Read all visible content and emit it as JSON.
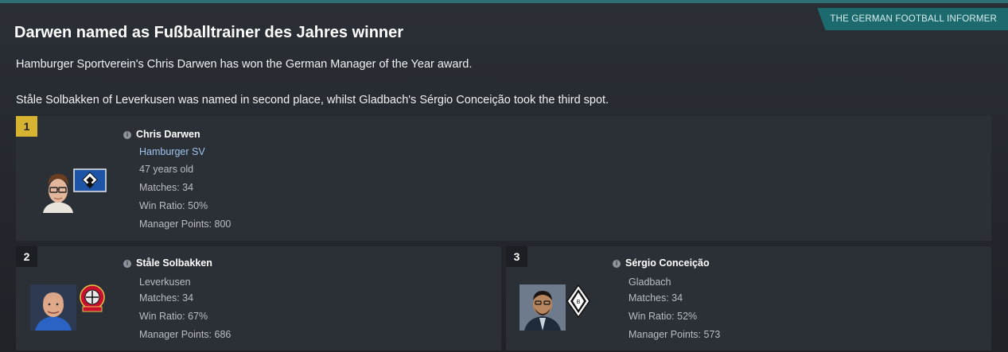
{
  "source": "THE GERMAN FOOTBALL INFORMER",
  "headline": "Darwen named as Fußballtrainer des Jahres winner",
  "paragraphs": [
    "Hamburger Sportverein's Chris Darwen has won the German Manager of the Year award.",
    "Ståle Solbakken of Leverkusen was named in second place, whilst Gladbach's Sérgio Conceição took the third spot."
  ],
  "winners": [
    {
      "rank": "1",
      "name": "Chris Darwen",
      "club": "Hamburger SV",
      "age": "47 years old",
      "matches": "Matches: 34",
      "win_ratio": "Win Ratio: 50%",
      "points": "Manager Points: 800"
    },
    {
      "rank": "2",
      "name": "Ståle Solbakken",
      "club": "Leverkusen",
      "matches": "Matches: 34",
      "win_ratio": "Win Ratio: 67%",
      "points": "Manager Points: 686"
    },
    {
      "rank": "3",
      "name": "Sérgio Conceição",
      "club": "Gladbach",
      "matches": "Matches: 34",
      "win_ratio": "Win Ratio: 52%",
      "points": "Manager Points: 573"
    }
  ],
  "info_icon_glyph": "i",
  "colors": {
    "accent_teal": "#1d6a6e",
    "rank_gold": "#d7b332",
    "link_blue": "#9fc5ee"
  }
}
